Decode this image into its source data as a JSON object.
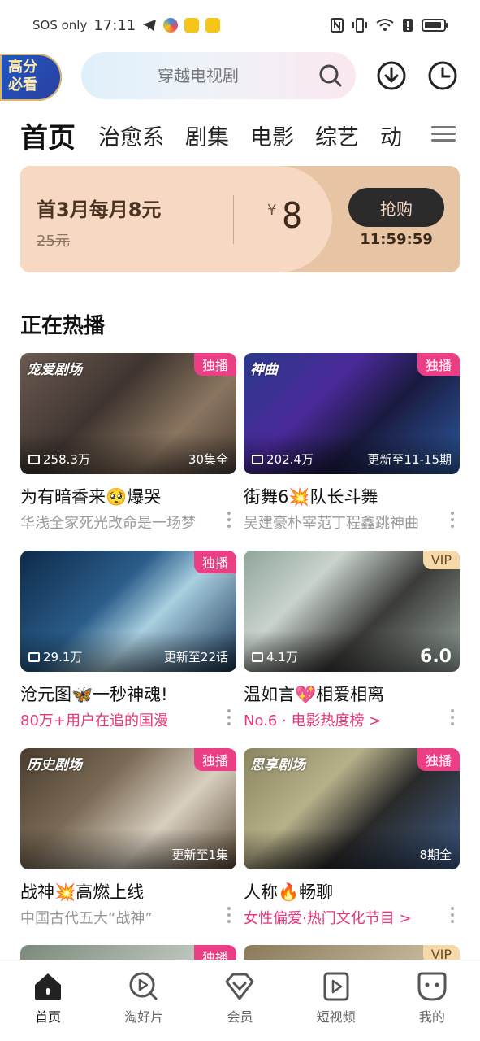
{
  "status_bar": {
    "carrier": "SOS only",
    "time": "17:11"
  },
  "header": {
    "promo_badge_line1": "高分",
    "promo_badge_line2": "必看",
    "search_placeholder": "穿越电视剧"
  },
  "tabs": [
    "首页",
    "治愈系",
    "剧集",
    "电影",
    "综艺",
    "动"
  ],
  "vip_banner": {
    "title": "首3月每月8元",
    "original_price": "25元",
    "currency": "¥",
    "price": "8",
    "buy_label": "抢购",
    "countdown": "11:59:59"
  },
  "section_title": "正在热播",
  "cards": [
    {
      "brand": "宠爱剧场",
      "badge": "独播",
      "badge_type": "exclusive",
      "views": "258.3万",
      "progress": "30集全",
      "score": "",
      "title": "为有暗香来🥺爆哭",
      "subtitle": "华浅全家死光改命是一场梦",
      "subtitle_style": "grey",
      "bg": "linear-gradient(135deg,#6b5a50 0%,#3f3530 40%,#8a7560 70%,#4a3d35 100%)"
    },
    {
      "brand": "神曲",
      "badge": "独播",
      "badge_type": "exclusive",
      "views": "202.4万",
      "progress": "更新至11-15期",
      "score": "",
      "title": "街舞6💥队长斗舞",
      "subtitle": "吴建豪朴宰范丁程鑫跳神曲",
      "subtitle_style": "grey",
      "bg": "linear-gradient(135deg,#2a3a8a 0%,#4a2a9a 35%,#1a1a40 60%,#2d5aa0 100%)"
    },
    {
      "brand": "",
      "badge": "独播",
      "badge_type": "exclusive",
      "views": "29.1万",
      "progress": "更新至22话",
      "score": "",
      "title": "沧元图🦋一秒神魂!",
      "subtitle": "80万+用户在追的国漫",
      "subtitle_style": "pink",
      "bg": "linear-gradient(135deg,#0e2a4a 0%,#2a5d8a 40%,#a9cfe0 60%,#15304f 100%)"
    },
    {
      "brand": "",
      "badge": "VIP",
      "badge_type": "vip",
      "views": "4.1万",
      "progress": "",
      "score": "6.0",
      "title": "温如言💖相爱相离",
      "subtitle": "No.6 · 电影热度榜 >",
      "subtitle_style": "pink",
      "bg": "linear-gradient(135deg,#8fa59a 0%,#c9d3cc 30%,#3b3b38 60%,#9aa89f 100%)"
    },
    {
      "brand": "历史剧场",
      "badge": "独播",
      "badge_type": "exclusive",
      "views": "",
      "progress": "更新至1集",
      "score": "",
      "title": "战神💥高燃上线",
      "subtitle": "中国古代五大“战神”",
      "subtitle_style": "grey",
      "bg": "linear-gradient(135deg,#4a3d2e 0%,#7a6a55 35%,#d8cfbf 65%,#5a4a38 100%)"
    },
    {
      "brand": "思享剧场",
      "badge": "独播",
      "badge_type": "exclusive",
      "views": "",
      "progress": "8期全",
      "score": "",
      "title": "人称🔥畅聊",
      "subtitle": "女性偏爱·热门文化节目 >",
      "subtitle_style": "pink",
      "bg": "linear-gradient(135deg,#8a8560 0%,#b7b18a 35%,#2a2a2a 60%,#3e5c8a 100%)"
    }
  ],
  "peek_cards": [
    {
      "badge": "独播",
      "badge_type": "exclusive"
    },
    {
      "badge": "VIP",
      "badge_type": "vip"
    }
  ],
  "bottom_nav": [
    {
      "label": "首页",
      "icon": "home-icon",
      "active": true
    },
    {
      "label": "淘好片",
      "icon": "discover-icon",
      "active": false
    },
    {
      "label": "会员",
      "icon": "vip-diamond-icon",
      "active": false
    },
    {
      "label": "短视频",
      "icon": "short-video-icon",
      "active": false
    },
    {
      "label": "我的",
      "icon": "profile-icon",
      "active": false
    }
  ]
}
